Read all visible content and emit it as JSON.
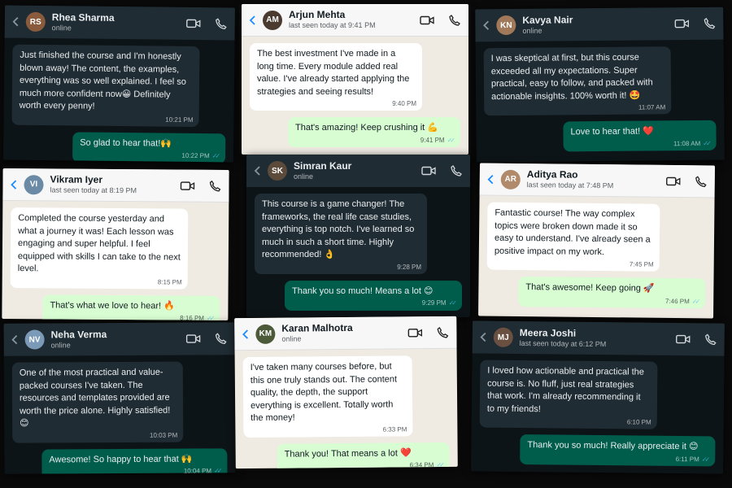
{
  "colors": {
    "dark_bg": "#0d1418",
    "dark_header": "#1f2c33",
    "dark_in": "#202c33",
    "dark_out": "#005c4b",
    "light_bg": "#efeae2",
    "light_in": "#ffffff",
    "light_out": "#d9fdd3",
    "ticks": "#53bdeb"
  },
  "icons": {
    "back": "chevron-left-icon",
    "video": "video-camera-icon",
    "call": "phone-icon",
    "read": "double-check-icon"
  },
  "chats": [
    {
      "name": "Rhea Sharma",
      "status": "online",
      "initials": "RS",
      "incoming": {
        "text": "Just finished the course and I'm honestly blown away! The content, the examples, everything was so well explained. I feel so much more confident now😀 Definitely worth every penny!",
        "time": "10:21 PM"
      },
      "outgoing": {
        "text": "So glad to hear that!🙌",
        "time": "10:22 PM"
      }
    },
    {
      "name": "Arjun Mehta",
      "status": "last seen today at 9:41 PM",
      "initials": "AM",
      "incoming": {
        "text": "The best investment I've made in a long time. Every module added real value. I've already started applying the strategies and seeing results!",
        "time": "9:40 PM"
      },
      "outgoing": {
        "text": "That's amazing! Keep crushing it 💪",
        "time": "9:41 PM"
      }
    },
    {
      "name": "Kavya Nair",
      "status": "online",
      "initials": "KN",
      "incoming": {
        "text": "I was skeptical at first, but this course exceeded all my expectations. Super practical, easy to follow, and packed with actionable insights. 100% worth it! 🤩",
        "time": "11:07 AM"
      },
      "outgoing": {
        "text": "Love to hear that! ❤️",
        "time": "11:08 AM"
      }
    },
    {
      "name": "Vikram Iyer",
      "status": "last seen today at 8:19 PM",
      "initials": "VI",
      "incoming": {
        "text": "Completed the course yesterday and what a journey it was! Each lesson was engaging and super helpful. I feel equipped with skills I can take to the next level.",
        "time": "8:15 PM"
      },
      "outgoing": {
        "text": "That's what we love to hear! 🔥",
        "time": "8:16 PM"
      }
    },
    {
      "name": "Simran Kaur",
      "status": "online",
      "initials": "SK",
      "incoming": {
        "text": "This course is a game changer! The frameworks, the real life case studies, everything is top notch. I've learned so much in such a short time. Highly recommended! 👌",
        "time": "9:28 PM"
      },
      "outgoing": {
        "text": "Thank you so much! Means a lot 😊",
        "time": "9:29 PM"
      }
    },
    {
      "name": "Aditya Rao",
      "status": "last seen today at 7:48 PM",
      "initials": "AR",
      "incoming": {
        "text": "Fantastic course! The way complex topics were broken down made it so easy to understand. I've already seen a positive impact on my work.",
        "time": "7:45 PM"
      },
      "outgoing": {
        "text": "That's awesome! Keep going 🚀",
        "time": "7:46 PM"
      }
    },
    {
      "name": "Neha Verma",
      "status": "online",
      "initials": "NV",
      "incoming": {
        "text": "One of the most practical and value-packed courses I've taken. The resources and templates provided are worth the price alone. Highly satisfied!😊",
        "time": "10:03 PM"
      },
      "outgoing": {
        "text": "Awesome! So happy to hear that 🙌",
        "time": "10:04 PM"
      }
    },
    {
      "name": "Karan Malhotra",
      "status": "online",
      "initials": "KM",
      "incoming": {
        "text": "I've taken many courses before, but this one truly stands out. The content quality, the depth, the support everything is excellent. Totally worth the money!",
        "time": "6:33 PM"
      },
      "outgoing": {
        "text": "Thank you! That means a lot ❤️",
        "time": "6:34 PM"
      }
    },
    {
      "name": "Meera Joshi",
      "status": "last seen today at 6:12 PM",
      "initials": "MJ",
      "incoming": {
        "text": "I loved how actionable and practical the course is. No fluff, just real strategies that work. I'm already recommending it to my friends!",
        "time": "6:10 PM"
      },
      "outgoing": {
        "text": "Thank you so much! Really appreciate it 😊",
        "time": "6:11 PM"
      }
    }
  ]
}
